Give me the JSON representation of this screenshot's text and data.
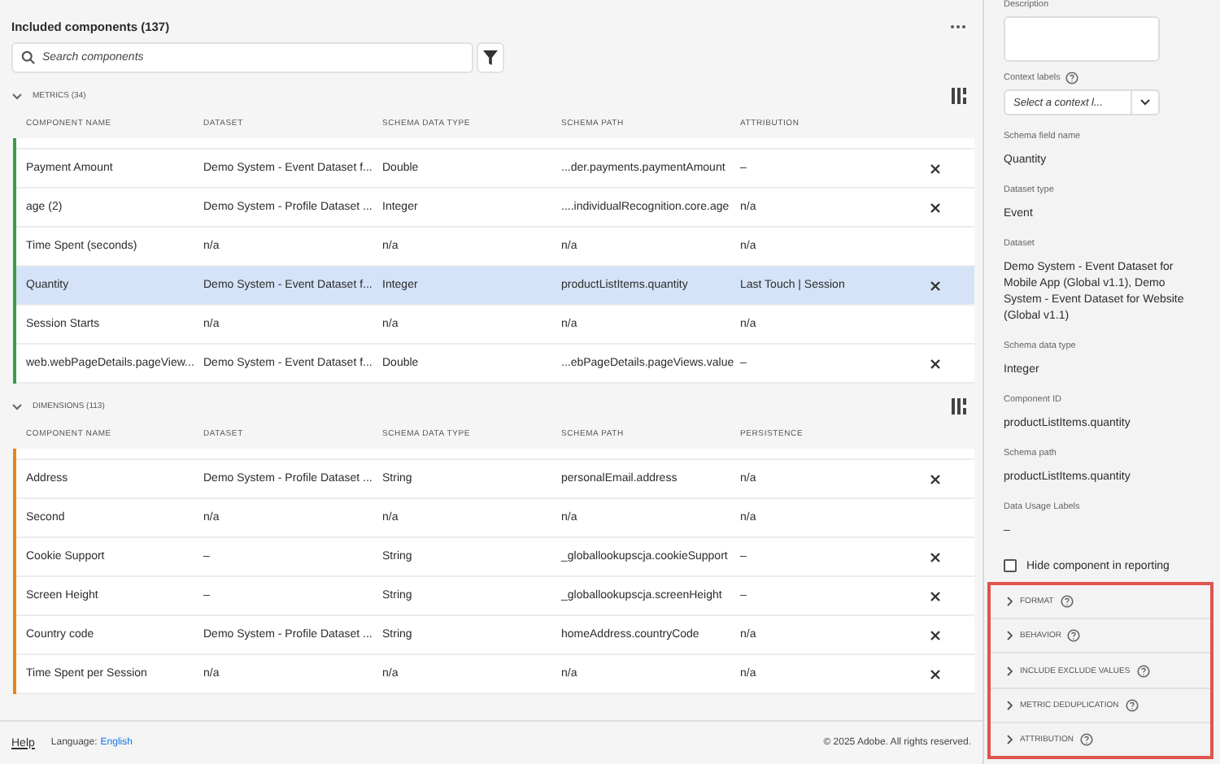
{
  "header": {
    "title": "Included components (137)"
  },
  "search": {
    "placeholder": "Search components"
  },
  "sections": [
    {
      "title": "METRICS (34)",
      "expanded": true,
      "color": "#3c9c4c",
      "columns": [
        "COMPONENT NAME",
        "DATASET",
        "SCHEMA DATA TYPE",
        "SCHEMA PATH",
        "ATTRIBUTION"
      ],
      "rows": [
        {
          "cells": [
            "Payment Amount",
            "Demo System - Event Dataset f...",
            "Double",
            "...der.payments.paymentAmount",
            "–"
          ],
          "selected": false,
          "removable": true
        },
        {
          "cells": [
            "age (2)",
            "Demo System - Profile Dataset ...",
            "Integer",
            "....individualRecognition.core.age",
            "n/a"
          ],
          "selected": false,
          "removable": true
        },
        {
          "cells": [
            "Time Spent (seconds)",
            "n/a",
            "n/a",
            "n/a",
            "n/a"
          ],
          "selected": false,
          "removable": false
        },
        {
          "cells": [
            "Quantity",
            "Demo System - Event Dataset f...",
            "Integer",
            "productListItems.quantity",
            "Last Touch | Session"
          ],
          "selected": true,
          "removable": true
        },
        {
          "cells": [
            "Session Starts",
            "n/a",
            "n/a",
            "n/a",
            "n/a"
          ],
          "selected": false,
          "removable": false
        },
        {
          "cells": [
            "web.webPageDetails.pageView...",
            "Demo System - Event Dataset f...",
            "Double",
            "...ebPageDetails.pageViews.value",
            "–"
          ],
          "selected": false,
          "removable": true
        }
      ]
    },
    {
      "title": "DIMENSIONS (113)",
      "expanded": true,
      "color": "#e68619",
      "columns": [
        "COMPONENT NAME",
        "DATASET",
        "SCHEMA DATA TYPE",
        "SCHEMA PATH",
        "PERSISTENCE"
      ],
      "rows": [
        {
          "cells": [
            "Address",
            "Demo System - Profile Dataset ...",
            "String",
            "personalEmail.address",
            "n/a"
          ],
          "selected": false,
          "removable": true
        },
        {
          "cells": [
            "Second",
            "n/a",
            "n/a",
            "n/a",
            "n/a"
          ],
          "selected": false,
          "removable": false
        },
        {
          "cells": [
            "Cookie Support",
            "–",
            "String",
            "_globallookupscja.cookieSupport",
            "–"
          ],
          "selected": false,
          "removable": true
        },
        {
          "cells": [
            "Screen Height",
            "–",
            "String",
            "_globallookupscja.screenHeight",
            "–"
          ],
          "selected": false,
          "removable": true
        },
        {
          "cells": [
            "Country code",
            "Demo System - Profile Dataset ...",
            "String",
            "homeAddress.countryCode",
            "n/a"
          ],
          "selected": false,
          "removable": true
        },
        {
          "cells": [
            "Time Spent per Session",
            "n/a",
            "n/a",
            "n/a",
            "n/a"
          ],
          "selected": false,
          "removable": true
        }
      ]
    }
  ],
  "footer": {
    "help": "Help",
    "language_label": "Language:",
    "language": "English",
    "copyright": "© 2025 Adobe. All rights reserved."
  },
  "panel": {
    "description_label": "Description",
    "context_labels": {
      "label": "Context labels",
      "placeholder": "Select a context l..."
    },
    "fields": [
      {
        "label": "Schema field name",
        "value": "Quantity"
      },
      {
        "label": "Dataset type",
        "value": "Event"
      },
      {
        "label": "Dataset",
        "value": "Demo System - Event Dataset for Mobile App (Global v1.1), Demo System - Event Dataset for Website (Global v1.1)"
      },
      {
        "label": "Schema data type",
        "value": "Integer"
      },
      {
        "label": "Component ID",
        "value": "productListItems.quantity"
      },
      {
        "label": "Schema path",
        "value": "productListItems.quantity"
      },
      {
        "label": "Data Usage Labels",
        "value": "–"
      }
    ],
    "hide_component": {
      "label": "Hide component in reporting",
      "checked": false
    },
    "accordions": [
      {
        "title": "FORMAT",
        "expanded": false
      },
      {
        "title": "BEHAVIOR",
        "expanded": false
      },
      {
        "title": "INCLUDE EXCLUDE VALUES",
        "expanded": false
      },
      {
        "title": "METRIC DEDUPLICATION",
        "expanded": false
      },
      {
        "title": "ATTRIBUTION",
        "expanded": false
      }
    ]
  }
}
